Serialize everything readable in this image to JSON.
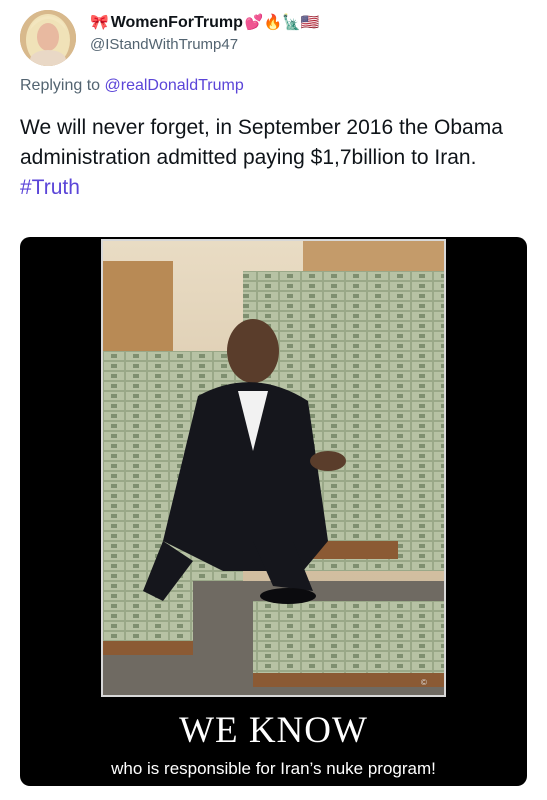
{
  "user": {
    "display_name": "WomenForTrump",
    "emoji_prefix": "🎀",
    "emoji_suffix": "💕🔥🗽🇺🇸",
    "handle": "@IStandWithTrump47"
  },
  "reply": {
    "prefix": "Replying to",
    "mention": "@realDonaldTrump"
  },
  "tweet": {
    "text": "We will never forget, in September 2016 the Obama administration admitted paying $1,7billion to Iran.",
    "hashtag": "#Truth"
  },
  "media": {
    "title": "WE KNOW",
    "subtitle": "who is responsible for Iran’s nuke program!"
  },
  "colors": {
    "link": "#5b45d8",
    "secondary_text": "#536471",
    "media_background": "#000000"
  }
}
